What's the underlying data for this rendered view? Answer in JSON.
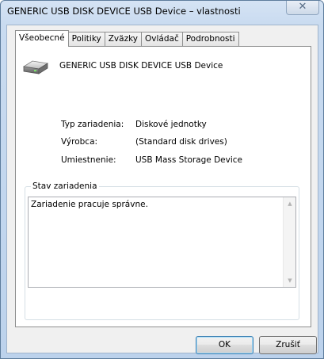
{
  "window": {
    "title": "GENERIC USB DISK DEVICE USB Device – vlastnosti",
    "close_glyph": "✕"
  },
  "tabs": [
    {
      "label": "Všeobecné",
      "active": true
    },
    {
      "label": "Politiky",
      "active": false
    },
    {
      "label": "Zväzky",
      "active": false
    },
    {
      "label": "Ovládač",
      "active": false
    },
    {
      "label": "Podrobnosti",
      "active": false
    }
  ],
  "device": {
    "icon": "disk-drive-icon",
    "name": "GENERIC USB DISK DEVICE USB Device"
  },
  "properties": [
    {
      "label": "Typ zariadenia:",
      "value": "Diskové jednotky"
    },
    {
      "label": "Výrobca:",
      "value": "(Standard disk drives)"
    },
    {
      "label": "Umiestnenie:",
      "value": "USB Mass Storage Device"
    }
  ],
  "status": {
    "legend": "Stav zariadenia",
    "text": "Zariadenie pracuje správne.",
    "scroll_up_glyph": "▲",
    "scroll_down_glyph": "▼"
  },
  "buttons": {
    "ok": "OK",
    "cancel": "Zrušiť"
  },
  "colors": {
    "titlebar": "#c9dbf0",
    "dialog_bg": "#f0f0f0",
    "default_button_border": "#3c7fb1"
  }
}
